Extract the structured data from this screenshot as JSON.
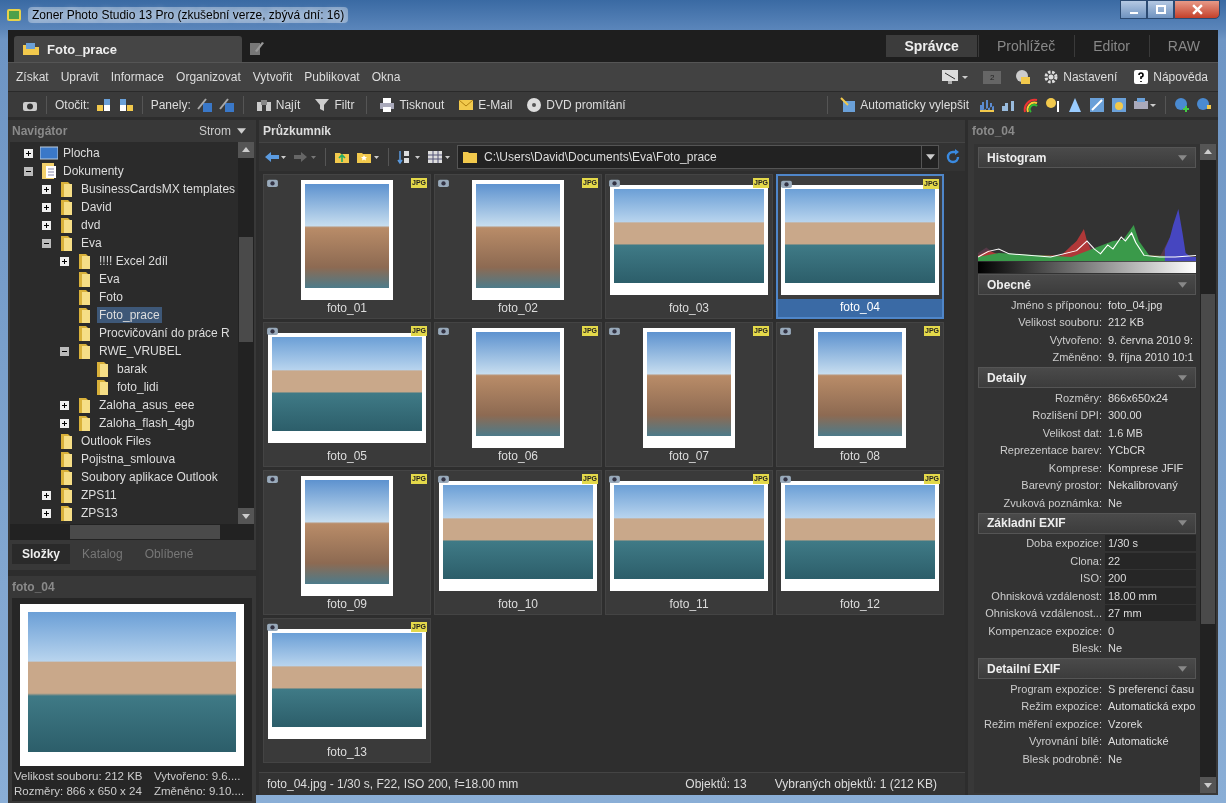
{
  "window": {
    "title": "Zoner Photo Studio 13 Pro (zkušební verze, zbývá dní: 16)"
  },
  "document_tab": {
    "label": "Foto_prace"
  },
  "mode_tabs": [
    {
      "label": "Správce",
      "selected": true
    },
    {
      "label": "Prohlížeč",
      "selected": false
    },
    {
      "label": "Editor",
      "selected": false
    },
    {
      "label": "RAW",
      "selected": false
    }
  ],
  "menu": [
    "Získat",
    "Upravit",
    "Informace",
    "Organizovat",
    "Vytvořit",
    "Publikovat",
    "Okna"
  ],
  "menu_right": {
    "monitor_badge": "2",
    "settings": "Nastavení",
    "help": "Nápověda"
  },
  "toolbar": {
    "rotate_label": "Otočit:",
    "panels_label": "Panely:",
    "find": "Najít",
    "filter": "Filtr",
    "print": "Tisknout",
    "email": "E-Mail",
    "dvd": "DVD promítání",
    "auto_enhance": "Automaticky vylepšit"
  },
  "navigator": {
    "title": "Navigátor",
    "view": "Strom",
    "tree": [
      {
        "label": "Plocha",
        "kind": "desktop",
        "expanded": false,
        "selected": false
      },
      {
        "label": "Dokumenty",
        "kind": "documents",
        "expanded": true,
        "selected": false,
        "children": [
          {
            "label": "BusinessCardsMX templates",
            "kind": "folder",
            "expanded": false,
            "selected": false
          },
          {
            "label": "David",
            "kind": "folder",
            "expanded": false,
            "selected": false
          },
          {
            "label": "dvd",
            "kind": "folder",
            "expanded": false,
            "selected": false
          },
          {
            "label": "Eva",
            "kind": "folder",
            "expanded": true,
            "selected": false,
            "children": [
              {
                "label": "!!!! Excel 2díl",
                "kind": "folder",
                "expanded": false,
                "selected": false
              },
              {
                "label": "Eva",
                "kind": "folder",
                "selected": false
              },
              {
                "label": "Foto",
                "kind": "folder",
                "selected": false
              },
              {
                "label": "Foto_prace",
                "kind": "folder",
                "selected": true
              },
              {
                "label": "Procvičování do práce R",
                "kind": "folder",
                "selected": false
              },
              {
                "label": "RWE_VRUBEL",
                "kind": "folder",
                "expanded": true,
                "selected": false,
                "children": [
                  {
                    "label": "barak",
                    "kind": "folder",
                    "selected": false
                  },
                  {
                    "label": "foto_lidi",
                    "kind": "folder",
                    "selected": false
                  }
                ]
              },
              {
                "label": "Zaloha_asus_eee",
                "kind": "folder",
                "expanded": false,
                "selected": false
              },
              {
                "label": "Zaloha_flash_4gb",
                "kind": "folder",
                "expanded": false,
                "selected": false
              }
            ]
          },
          {
            "label": "Outlook Files",
            "kind": "folder",
            "selected": false
          },
          {
            "label": "Pojistna_smlouva",
            "kind": "folder",
            "selected": false
          },
          {
            "label": "Soubory aplikace Outlook",
            "kind": "folder",
            "selected": false
          },
          {
            "label": "ZPS11",
            "kind": "folder",
            "expanded": false,
            "selected": false
          },
          {
            "label": "ZPS13",
            "kind": "folder",
            "expanded": false,
            "selected": false
          }
        ]
      }
    ],
    "tabs": [
      {
        "label": "Složky",
        "selected": true
      },
      {
        "label": "Katalog",
        "selected": false
      },
      {
        "label": "Oblíbené",
        "selected": false
      }
    ]
  },
  "preview": {
    "title": "foto_04",
    "info": [
      "Velikost souboru: 212 KB",
      "Vytvořeno: 9.6....",
      "Rozměry: 866 x 650 x 24",
      "Změněno: 9.10...."
    ]
  },
  "explorer": {
    "title": "Průzkumník",
    "path": "C:\\Users\\David\\Documents\\Eva\\Foto_prace",
    "items": [
      {
        "name": "foto_01",
        "badge": "JPG",
        "kind": "portrait",
        "selected": false
      },
      {
        "name": "foto_02",
        "badge": "JPG",
        "kind": "portrait",
        "selected": false
      },
      {
        "name": "foto_03",
        "badge": "JPG",
        "kind": "landscape",
        "selected": false
      },
      {
        "name": "foto_04",
        "badge": "JPG",
        "kind": "landscape",
        "selected": true
      },
      {
        "name": "foto_05",
        "badge": "JPG",
        "kind": "landscape",
        "selected": false
      },
      {
        "name": "foto_06",
        "badge": "JPG",
        "kind": "portrait",
        "selected": false
      },
      {
        "name": "foto_07",
        "badge": "JPG",
        "kind": "portrait",
        "selected": false
      },
      {
        "name": "foto_08",
        "badge": "JPG",
        "kind": "portrait",
        "selected": false
      },
      {
        "name": "foto_09",
        "badge": "JPG",
        "kind": "portrait",
        "selected": false
      },
      {
        "name": "foto_10",
        "badge": "JPG",
        "kind": "landscape",
        "selected": false
      },
      {
        "name": "foto_11",
        "badge": "JPG",
        "kind": "landscape",
        "selected": false
      },
      {
        "name": "foto_12",
        "badge": "JPG",
        "kind": "landscape",
        "selected": false
      },
      {
        "name": "foto_13",
        "badge": "JPG",
        "kind": "landscape",
        "selected": false
      }
    ],
    "status": {
      "info": "foto_04.jpg - 1/30 s, F22, ISO 200, f=18.00 mm",
      "count": "Objektů: 13",
      "selected": "Vybraných objektů: 1 (212 KB)"
    }
  },
  "properties": {
    "title": "foto_04",
    "sections": [
      {
        "title": "Histogram",
        "kind": "histogram"
      },
      {
        "title": "Obecné",
        "kind": "rows",
        "rows": [
          {
            "label": "Jméno s příponou:",
            "value": "foto_04.jpg",
            "kind": "text"
          },
          {
            "label": "Velikost souboru:",
            "value": "212 KB",
            "kind": "text"
          },
          {
            "label": "Vytvořeno:",
            "value": "9. června 2010 9:",
            "kind": "text"
          },
          {
            "label": "Změněno:",
            "value": "9. října 2010 10:1",
            "kind": "text"
          }
        ]
      },
      {
        "title": "Detaily",
        "kind": "rows",
        "rows": [
          {
            "label": "Rozměry:",
            "value": "866x650x24",
            "kind": "text"
          },
          {
            "label": "Rozlišení DPI:",
            "value": "300.00",
            "kind": "text"
          },
          {
            "label": "Velikost dat:",
            "value": "1.6 MB",
            "kind": "text"
          },
          {
            "label": "Reprezentace barev:",
            "value": "YCbCR",
            "kind": "text"
          },
          {
            "label": "Komprese:",
            "value": "Komprese JFIF",
            "kind": "text"
          },
          {
            "label": "Barevný prostor:",
            "value": "Nekalibrovaný",
            "kind": "text"
          },
          {
            "label": "Zvuková poznámka:",
            "value": "Ne",
            "kind": "text"
          }
        ]
      },
      {
        "title": "Základní EXIF",
        "kind": "rows",
        "rows": [
          {
            "label": "Doba expozice:",
            "value": "1/30 s",
            "kind": "field"
          },
          {
            "label": "Clona:",
            "value": "22",
            "kind": "field"
          },
          {
            "label": "ISO:",
            "value": "200",
            "kind": "field"
          },
          {
            "label": "Ohnisková vzdálenost:",
            "value": "18.00 mm",
            "kind": "field"
          },
          {
            "label": "Ohnisková vzdálenost...",
            "value": "27 mm",
            "kind": "field"
          },
          {
            "label": "Kompenzace expozice:",
            "value": "0",
            "kind": "text"
          },
          {
            "label": "Blesk:",
            "value": "Ne",
            "kind": "text"
          }
        ]
      },
      {
        "title": "Detailní EXIF",
        "kind": "rows",
        "rows": [
          {
            "label": "Program expozice:",
            "value": "S preferencí času",
            "kind": "text"
          },
          {
            "label": "Režim expozice:",
            "value": "Automatická expo",
            "kind": "text"
          },
          {
            "label": "Režim měření expozice:",
            "value": "Vzorek",
            "kind": "text"
          },
          {
            "label": "Vyrovnání bílé:",
            "value": "Automatické",
            "kind": "text"
          },
          {
            "label": "Blesk podrobně:",
            "value": "Ne",
            "kind": "text"
          }
        ]
      }
    ]
  }
}
